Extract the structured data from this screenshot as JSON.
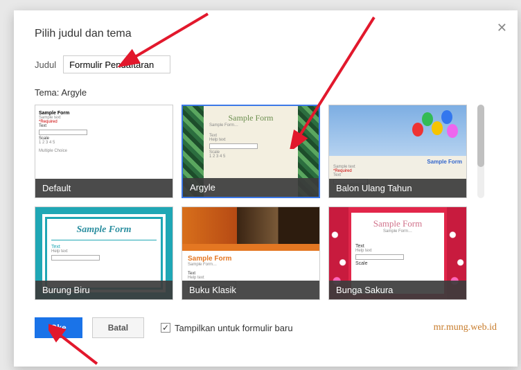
{
  "dialog": {
    "title": "Pilih judul dan tema",
    "close_symbol": "✕",
    "judul_label": "Judul",
    "judul_value": "Formulir Pendaftaran",
    "tema_label_prefix": "Tema:",
    "selected_theme": "Argyle"
  },
  "themes": [
    {
      "id": "default",
      "label": "Default",
      "selected": false
    },
    {
      "id": "argyle",
      "label": "Argyle",
      "selected": true
    },
    {
      "id": "balon",
      "label": "Balon Ulang Tahun",
      "selected": false
    },
    {
      "id": "burung",
      "label": "Burung Biru",
      "selected": false
    },
    {
      "id": "buku",
      "label": "Buku Klasik",
      "selected": false
    },
    {
      "id": "bunga",
      "label": "Bunga Sakura",
      "selected": false
    }
  ],
  "preview_text": {
    "sample_form": "Sample Form",
    "sample_form_dots": "Sample Form…",
    "required": "*Required",
    "text": "Text",
    "help_text": "Help text",
    "scale": "Scale",
    "scale_nums": "1  2  3  4  5",
    "multiple_choice": "Multiple Choice",
    "sample_text": "Sample text"
  },
  "footer": {
    "ok_label": "Oke",
    "cancel_label": "Batal",
    "checkbox_label": "Tampilkan untuk formulir baru",
    "checkbox_checked": true,
    "watermark": "mr.mung.web.id"
  },
  "colors": {
    "primary": "#1a73e8",
    "arrow": "#e2182c"
  }
}
